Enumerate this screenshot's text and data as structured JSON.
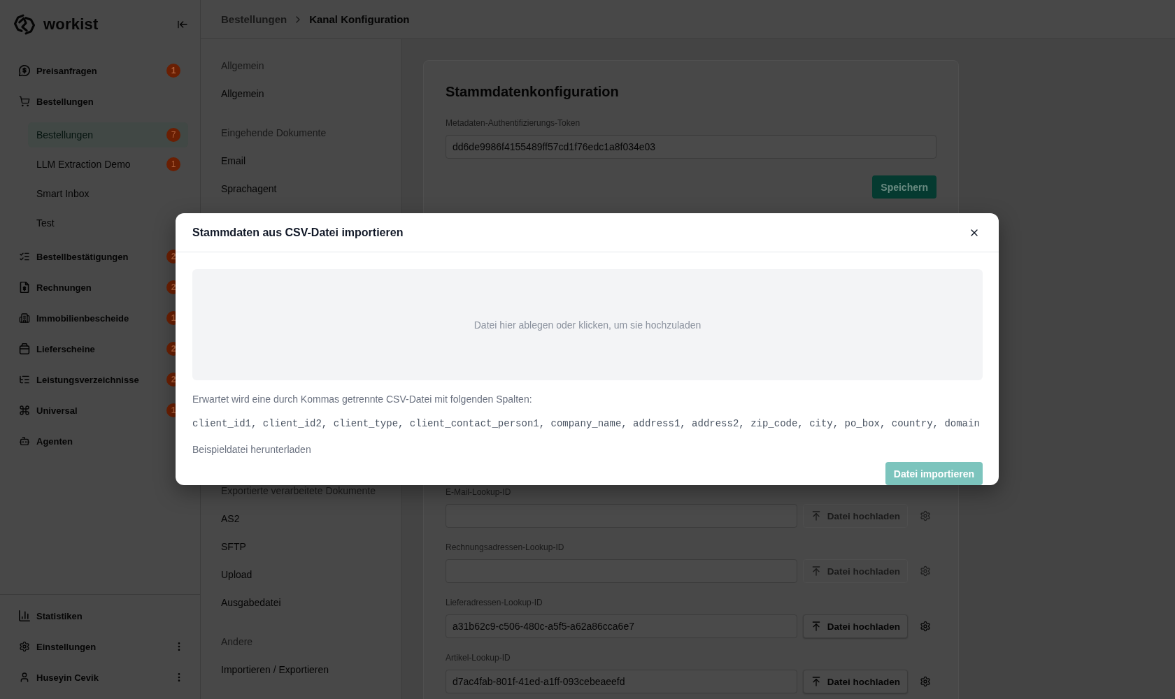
{
  "sidebar": {
    "logo": "workist",
    "nav": [
      {
        "label": "Preisanfragen",
        "badge": "1",
        "selected": false
      },
      {
        "label": "Bestellungen",
        "selected": false,
        "children": [
          {
            "label": "Bestellungen",
            "badge": "7",
            "selected": true
          },
          {
            "label": "LLM Extraction Demo",
            "badge": "1",
            "selected": false
          },
          {
            "label": "Smart Inbox",
            "selected": false
          },
          {
            "label": "Test",
            "selected": false
          }
        ]
      },
      {
        "label": "Bestellbestätigungen",
        "badge": "2",
        "selected": false
      },
      {
        "label": "Rechnungen",
        "badge": "2",
        "selected": false
      },
      {
        "label": "Immobilienbescheide",
        "badge": "1",
        "selected": false
      },
      {
        "label": "Lieferscheine",
        "badge": "2",
        "selected": false
      },
      {
        "label": "Leistungsverzeichnisse",
        "badge": "2",
        "selected": false
      },
      {
        "label": "Universal",
        "badge": "1",
        "selected": false
      },
      {
        "label": "Agenten",
        "selected": false
      }
    ],
    "footer": [
      {
        "label": "Statistiken",
        "menu": false
      },
      {
        "label": "Einstellungen",
        "menu": true
      },
      {
        "label": "Huseyin Cevik",
        "menu": true
      }
    ]
  },
  "breadcrumb": [
    {
      "label": "Bestellungen",
      "current": false
    },
    {
      "label": "Kanal Konfiguration",
      "current": true
    }
  ],
  "subnav": {
    "upper_groups": [
      {
        "title": "Allgemein",
        "items": [
          "Allgemein"
        ]
      },
      {
        "title": "Eingehende Dokumente",
        "items": [
          "Email",
          "Sprachagent"
        ]
      }
    ],
    "lower_groups": [
      {
        "title": "Exportierte verarbeitete Dokumente",
        "items": [
          "AS2",
          "SFTP",
          "Upload",
          "Ausgabedatei"
        ]
      },
      {
        "title": "Andere",
        "items": [
          "Importieren / Exportieren"
        ]
      }
    ]
  },
  "config_card": {
    "title": "Stammdatenkonfiguration",
    "token_field": {
      "label": "Metadaten-Authentifizierungs-Token",
      "value": "dd6de9986f4155489ff57cd1f76edc1a8f034e03"
    },
    "save_button": "Speichern",
    "lookup_fields": [
      {
        "label": "E-Mail-Lookup-ID",
        "upload_button": {
          "label": "Datei hochladen",
          "disabled": true
        }
      },
      {
        "label": "Rechnungsadressen-Lookup-ID",
        "upload_button": {
          "label": "Datei hochladen",
          "disabled": true
        }
      },
      {
        "label": "Lieferadressen-Lookup-ID",
        "value": "a31b62c9-c506-480c-a5f5-a62a86cca6e7",
        "upload_button": {
          "label": "Datei hochladen",
          "disabled": false
        }
      },
      {
        "label": "Artikel-Lookup-ID",
        "value": "d7ac4fab-801f-41ed-a1ff-093cebeaeefd",
        "upload_button": {
          "label": "Datei hochladen",
          "disabled": false
        }
      }
    ]
  },
  "import_modal": {
    "title": "Stammdaten aus CSV-Datei importieren",
    "dropzone": "Datei hier ablegen oder klicken, um sie hochzuladen",
    "description": "Erwartet wird eine durch Kommas getrennte CSV-Datei mit folgenden Spalten:",
    "columns": "client_id1, client_id2, client_type, client_contact_person1, company_name, address1, address2, zip_code, city, po_box, country, domain",
    "download_link": "Beispieldatei herunterladen",
    "import_button": {
      "label": "Datei importieren",
      "disabled": true
    }
  }
}
